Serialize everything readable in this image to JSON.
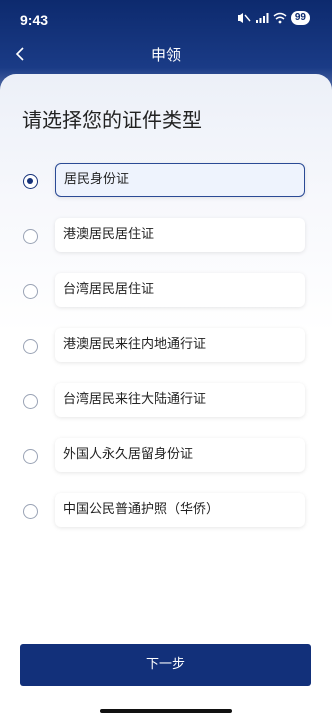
{
  "status_bar": {
    "time": "9:43",
    "battery": "99"
  },
  "nav": {
    "title": "申领"
  },
  "heading": "请选择您的证件类型",
  "options": [
    {
      "label": "居民身份证",
      "selected": true
    },
    {
      "label": "港澳居民居住证",
      "selected": false
    },
    {
      "label": "台湾居民居住证",
      "selected": false
    },
    {
      "label": "港澳居民来往内地通行证",
      "selected": false
    },
    {
      "label": "台湾居民来往大陆通行证",
      "selected": false
    },
    {
      "label": "外国人永久居留身份证",
      "selected": false
    },
    {
      "label": "中国公民普通护照（华侨）",
      "selected": false
    }
  ],
  "next_button": "下一步",
  "colors": {
    "primary": "#12307a",
    "header_dark": "#0d2a6e",
    "selected_bg": "#eef3fd"
  }
}
